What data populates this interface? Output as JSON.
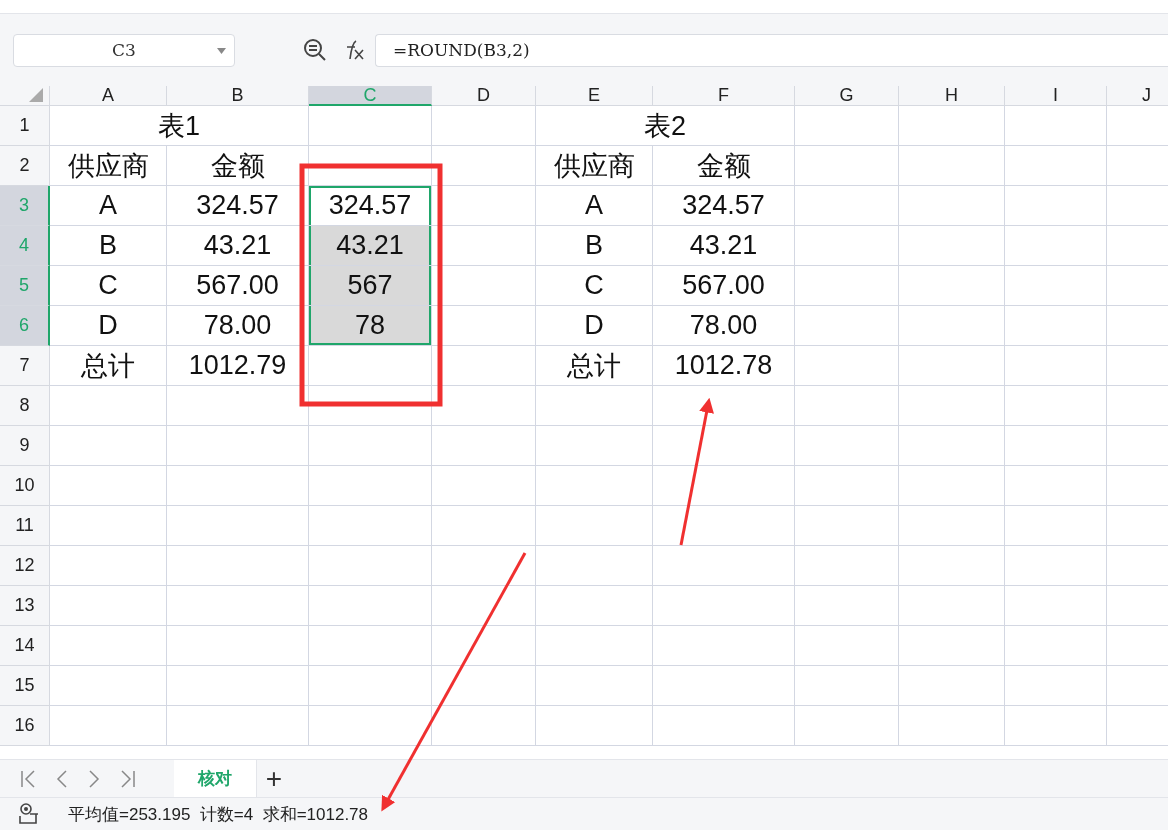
{
  "name_box": {
    "value": "C3"
  },
  "formula_bar": {
    "value": "=ROUND(B3,2)"
  },
  "columns": [
    {
      "label": "A",
      "selected": false
    },
    {
      "label": "B",
      "selected": false
    },
    {
      "label": "C",
      "selected": true
    },
    {
      "label": "D",
      "selected": false
    },
    {
      "label": "E",
      "selected": false
    },
    {
      "label": "F",
      "selected": false
    },
    {
      "label": "G",
      "selected": false
    },
    {
      "label": "H",
      "selected": false
    },
    {
      "label": "I",
      "selected": false
    },
    {
      "label": "J",
      "selected": false
    }
  ],
  "rows": [
    {
      "label": "1",
      "selected": false,
      "kind": "merged",
      "cells": [
        "表1",
        null,
        null,
        null,
        "表2",
        null,
        null,
        null,
        null,
        null
      ]
    },
    {
      "label": "2",
      "selected": false,
      "kind": "plain",
      "cells": [
        "供应商",
        "金额",
        null,
        null,
        "供应商",
        "金额",
        null,
        null,
        null,
        null
      ]
    },
    {
      "label": "3",
      "selected": true,
      "kind": "plain",
      "cells": [
        "A",
        "324.57",
        "324.57",
        null,
        "A",
        "324.57",
        null,
        null,
        null,
        null
      ]
    },
    {
      "label": "4",
      "selected": true,
      "kind": "plain",
      "cells": [
        "B",
        "43.21",
        "43.21",
        null,
        "B",
        "43.21",
        null,
        null,
        null,
        null
      ]
    },
    {
      "label": "5",
      "selected": true,
      "kind": "plain",
      "cells": [
        "C",
        "567.00",
        "567",
        null,
        "C",
        "567.00",
        null,
        null,
        null,
        null
      ]
    },
    {
      "label": "6",
      "selected": true,
      "kind": "plain",
      "cells": [
        "D",
        "78.00",
        "78",
        null,
        "D",
        "78.00",
        null,
        null,
        null,
        null
      ]
    },
    {
      "label": "7",
      "selected": false,
      "kind": "plain",
      "cells": [
        "总计",
        "1012.79",
        null,
        null,
        "总计",
        "1012.78",
        null,
        null,
        null,
        null
      ]
    },
    {
      "label": "8",
      "selected": false,
      "kind": "plain",
      "cells": [
        null,
        null,
        null,
        null,
        null,
        null,
        null,
        null,
        null,
        null
      ]
    },
    {
      "label": "9",
      "selected": false,
      "kind": "plain",
      "cells": [
        null,
        null,
        null,
        null,
        null,
        null,
        null,
        null,
        null,
        null
      ]
    },
    {
      "label": "10",
      "selected": false,
      "kind": "plain",
      "cells": [
        null,
        null,
        null,
        null,
        null,
        null,
        null,
        null,
        null,
        null
      ]
    },
    {
      "label": "11",
      "selected": false,
      "kind": "plain",
      "cells": [
        null,
        null,
        null,
        null,
        null,
        null,
        null,
        null,
        null,
        null
      ]
    },
    {
      "label": "12",
      "selected": false,
      "kind": "plain",
      "cells": [
        null,
        null,
        null,
        null,
        null,
        null,
        null,
        null,
        null,
        null
      ]
    },
    {
      "label": "13",
      "selected": false,
      "kind": "plain",
      "cells": [
        null,
        null,
        null,
        null,
        null,
        null,
        null,
        null,
        null,
        null
      ]
    },
    {
      "label": "14",
      "selected": false,
      "kind": "plain",
      "cells": [
        null,
        null,
        null,
        null,
        null,
        null,
        null,
        null,
        null,
        null
      ]
    },
    {
      "label": "15",
      "selected": false,
      "kind": "plain",
      "cells": [
        null,
        null,
        null,
        null,
        null,
        null,
        null,
        null,
        null,
        null
      ]
    },
    {
      "label": "16",
      "selected": false,
      "kind": "plain",
      "cells": [
        null,
        null,
        null,
        null,
        null,
        null,
        null,
        null,
        null,
        null
      ]
    }
  ],
  "sheet_tabs": [
    {
      "label": "核对",
      "selected": true
    }
  ],
  "add_sheet": "+",
  "status_bar": {
    "text": "平均值=253.195  计数=4  求和=1012.78"
  }
}
